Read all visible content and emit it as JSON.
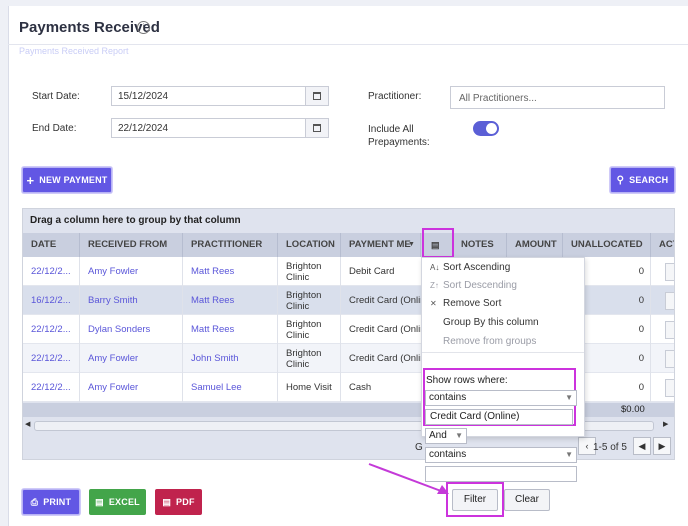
{
  "page": {
    "title": "Payments Received",
    "ghost_text": "Payments Received Report"
  },
  "form": {
    "start_date_label": "Start Date:",
    "start_date_value": "15/12/2024",
    "end_date_label": "End Date:",
    "end_date_value": "22/12/2024",
    "practitioner_label": "Practitioner:",
    "practitioner_placeholder": "All Practitioners...",
    "prepayments_label_line1": "Include All",
    "prepayments_label_line2": "Prepayments:",
    "prepayments_enabled": true
  },
  "buttons": {
    "new_payment": "NEW PAYMENT",
    "search": "SEARCH",
    "print": "PRINT",
    "excel": "EXCEL",
    "pdf": "PDF"
  },
  "grid": {
    "group_hint": "Drag a column here to group by that column",
    "columns": [
      "DATE",
      "RECEIVED FROM",
      "PRACTITIONER",
      "LOCATION",
      "PAYMENT ME",
      "NOTES",
      "AMOUNT",
      "UNALLOCATED",
      "ACT"
    ],
    "rows": [
      {
        "date": "22/12/2...",
        "from": "Amy Fowler",
        "practitioner": "Matt Rees",
        "location1": "Brighton",
        "location2": "Clinic",
        "method": "Debit Card",
        "unallocated": "0"
      },
      {
        "date": "16/12/2...",
        "from": "Barry Smith",
        "practitioner": "Matt Rees",
        "location1": "Brighton",
        "location2": "Clinic",
        "method": "Credit Card (Onlin",
        "unallocated": "0"
      },
      {
        "date": "22/12/2...",
        "from": "Dylan Sonders",
        "practitioner": "Matt Rees",
        "location1": "Brighton",
        "location2": "Clinic",
        "method": "Credit Card (Onlin",
        "unallocated": "0"
      },
      {
        "date": "22/12/2...",
        "from": "Amy Fowler",
        "practitioner": "John Smith",
        "location1": "Brighton",
        "location2": "Clinic",
        "method": "Credit Card (Onlin",
        "unallocated": "0"
      },
      {
        "date": "22/12/2...",
        "from": "Amy Fowler",
        "practitioner": "Samuel Lee",
        "location1": "Home Visit",
        "location2": "",
        "method": "Cash",
        "unallocated": "0"
      }
    ],
    "footer_total": "$0.00",
    "pager_g": "G",
    "pager_range": "1-5 of 5"
  },
  "column_menu": {
    "sort_asc": "Sort Ascending",
    "sort_desc": "Sort Descending",
    "remove_sort": "Remove Sort",
    "group_by": "Group By this column",
    "remove_groups": "Remove from groups",
    "show_rows": "Show rows where:",
    "op1": "contains",
    "value1": "Credit Card (Online)",
    "logic": "And",
    "op2": "contains",
    "value2": "",
    "filter_button": "Filter",
    "clear_button": "Clear"
  },
  "colors": {
    "accent": "#6257e4",
    "highlight": "#cc33dd",
    "excel": "#43a54a",
    "pdf": "#c0234d"
  }
}
